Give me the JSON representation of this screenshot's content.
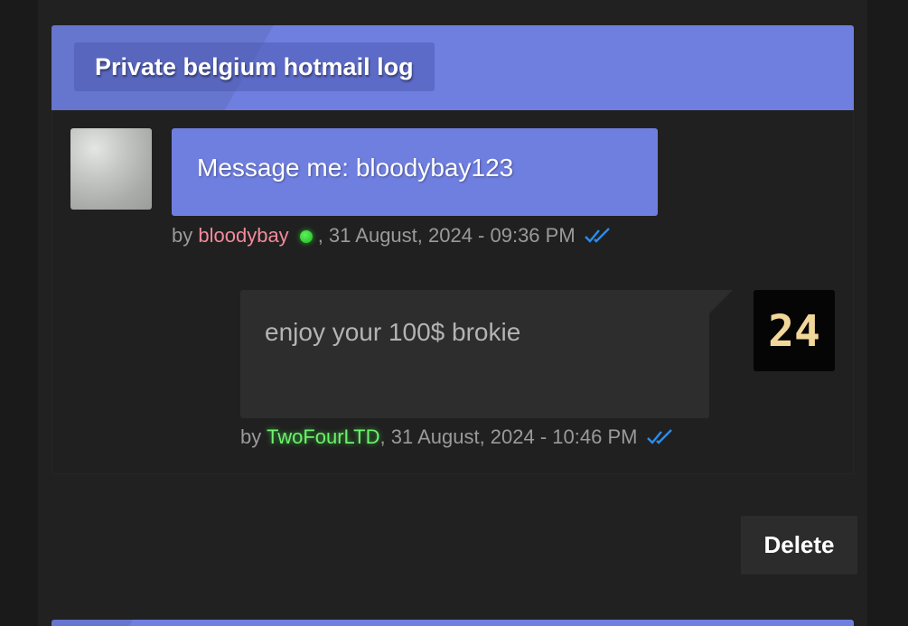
{
  "thread": {
    "title": "Private belgium hotmail log"
  },
  "messages": [
    {
      "text": "Message me: bloodybay123",
      "by_label": "by",
      "author": "bloodybay",
      "online": true,
      "timestamp": ", 31 August, 2024 - 09:36 PM",
      "read_icon": "double-check-icon",
      "avatar": "user-avatar-photo"
    },
    {
      "text": "enjoy your 100$ brokie",
      "by_label": "by",
      "author": "TwoFourLTD",
      "timestamp": ", 31 August, 2024 - 10:46 PM",
      "read_icon": "double-check-icon",
      "avatar": "user-avatar-24"
    }
  ],
  "avatar2_text": "24",
  "actions": {
    "delete_label": "Delete"
  },
  "colors": {
    "accent": "#6f7fe0",
    "user_red": "#f28a9b",
    "user_green": "#70f070",
    "online": "#22c022",
    "check": "#2a8df0",
    "avatar_digits": "#f2d79a"
  }
}
